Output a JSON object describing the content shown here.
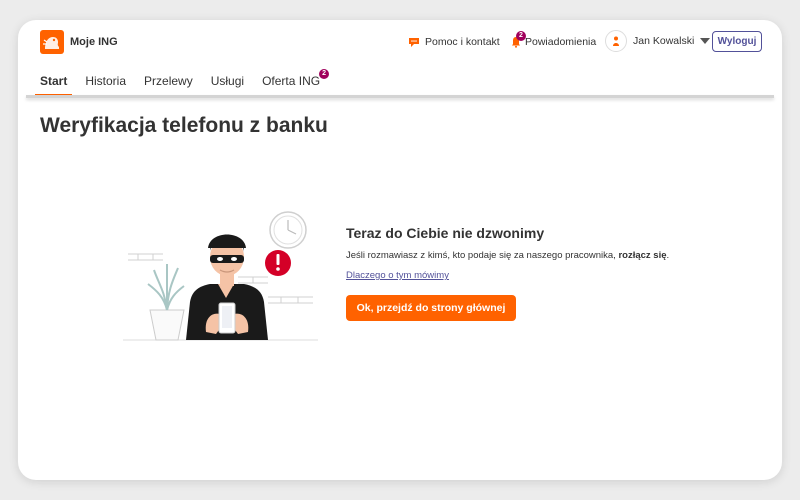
{
  "app": {
    "title": "Moje ING"
  },
  "header": {
    "help_label": "Pomoc i kontakt",
    "notifications_label": "Powiadomienia",
    "notifications_count": "2",
    "user_name": "Jan Kowalski",
    "logout_label": "Wyloguj"
  },
  "tabs": [
    {
      "label": "Start",
      "active": true
    },
    {
      "label": "Historia",
      "active": false
    },
    {
      "label": "Przelewy",
      "active": false
    },
    {
      "label": "Usługi",
      "active": false
    },
    {
      "label": "Oferta ING",
      "active": false,
      "badge": "2"
    }
  ],
  "page": {
    "title": "Weryfikacja telefonu z banku",
    "heading": "Teraz do Ciebie nie dzwonimy",
    "description_prefix": "Jeśli rozmawiasz z kimś, kto podaje się za naszego pracownika, ",
    "description_bold": "rozłącz się",
    "description_suffix": ".",
    "link": "Dlaczego o tym mówimy",
    "button": "Ok, przejdź do strony głównej"
  },
  "colors": {
    "accent": "#ff6200",
    "link": "#525199",
    "badge": "#a0005c",
    "alert": "#d40027"
  },
  "icons": [
    "ing-lion-logo",
    "chat-icon",
    "bell-icon",
    "user-icon",
    "chevron-down-icon",
    "alert-icon",
    "clock-icon"
  ]
}
